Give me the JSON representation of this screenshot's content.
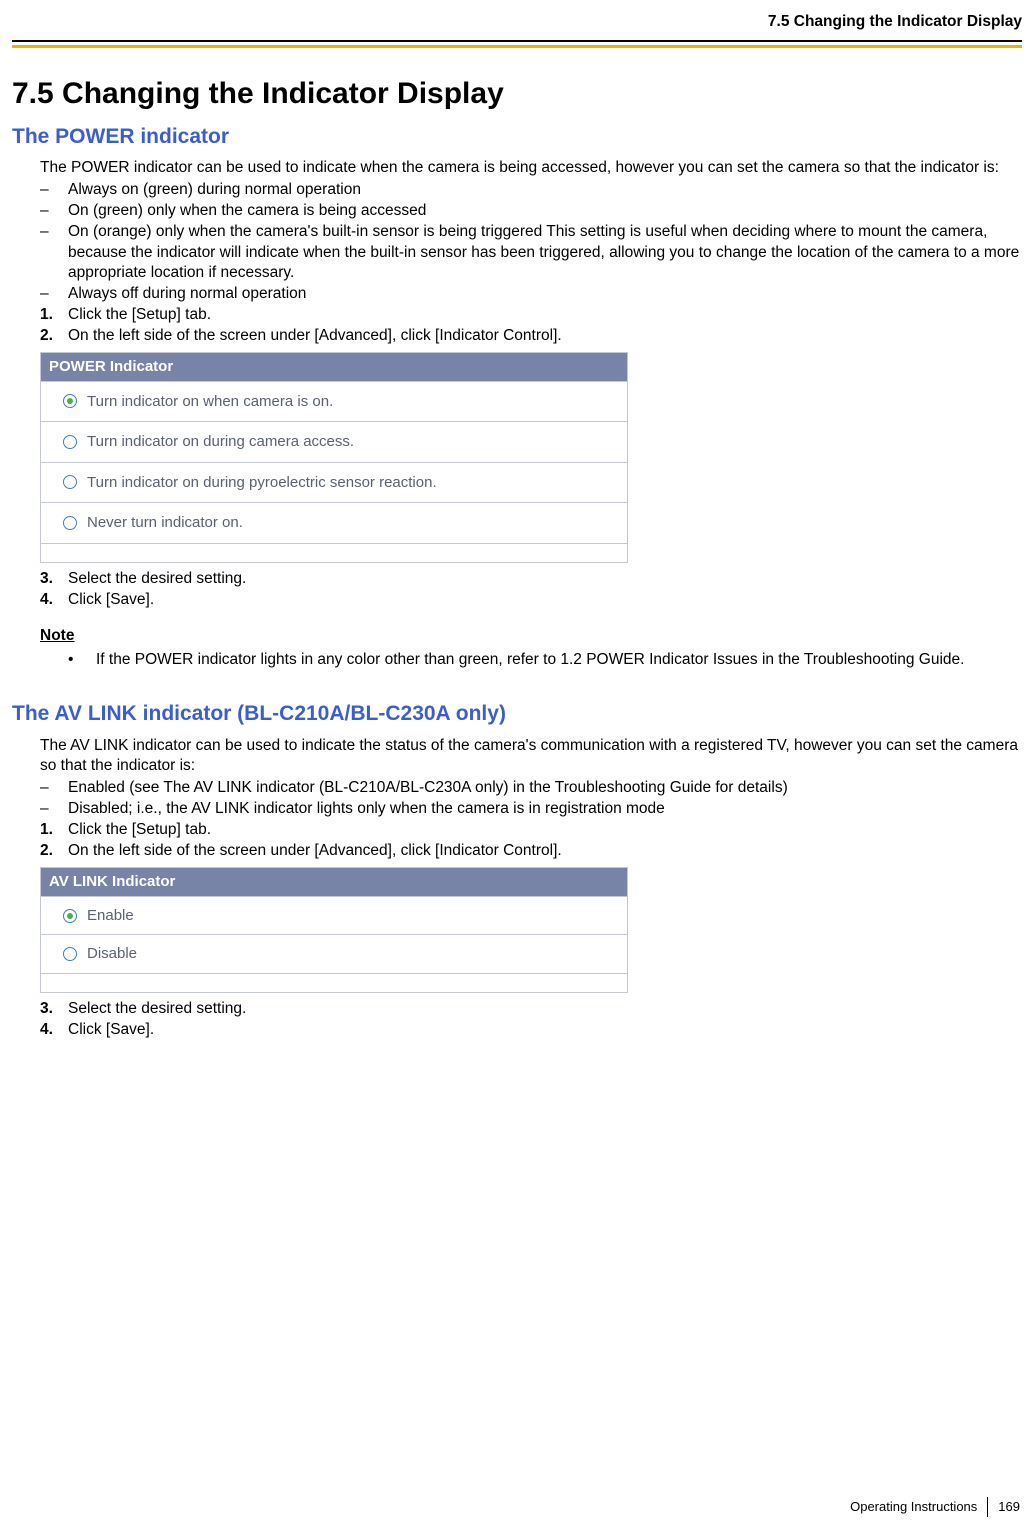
{
  "header": {
    "running": "7.5 Changing the Indicator Display"
  },
  "title": "7.5  Changing the Indicator Display",
  "sec1": {
    "heading": "The POWER indicator",
    "intro": "The POWER indicator can be used to indicate when the camera is being accessed, however you can set the camera so that the indicator is:",
    "dashes": [
      "Always on (green) during normal operation",
      "On (green) only when the camera is being accessed",
      "On (orange) only when the camera's built-in sensor is being triggered\nThis setting is useful when deciding where to mount the camera, because the indicator will indicate when the built-in sensor has been triggered, allowing you to change the location of the camera to a more appropriate location if necessary.",
      "Always off during normal operation"
    ],
    "steps1": [
      "Click the [Setup] tab.",
      "On the left side of the screen under [Advanced], click [Indicator Control]."
    ],
    "panel": {
      "title": "POWER Indicator",
      "options": [
        {
          "label": "Turn indicator on when camera is on.",
          "checked": true
        },
        {
          "label": "Turn indicator on during camera access.",
          "checked": false
        },
        {
          "label": "Turn indicator on during pyroelectric sensor reaction.",
          "checked": false
        },
        {
          "label": "Never turn indicator on.",
          "checked": false
        }
      ]
    },
    "steps2": [
      "Select the desired setting.",
      "Click [Save]."
    ],
    "noteLabel": "Note",
    "noteText": "If the POWER indicator lights in any color other than green, refer to 1.2  POWER Indicator Issues in the Troubleshooting Guide."
  },
  "sec2": {
    "heading": "The AV LINK indicator (BL-C210A/BL-C230A only)",
    "intro": "The AV LINK indicator can be used to indicate the status of the camera's communication with a registered TV, however you can set the camera so that the indicator is:",
    "dashes": [
      "Enabled (see The AV LINK indicator (BL-C210A/BL-C230A only) in the Troubleshooting Guide for details)",
      "Disabled; i.e., the AV LINK indicator lights only when the camera is in registration mode"
    ],
    "steps1": [
      "Click the [Setup] tab.",
      "On the left side of the screen under [Advanced], click [Indicator Control]."
    ],
    "panel": {
      "title": "AV LINK Indicator",
      "options": [
        {
          "label": "Enable",
          "checked": true
        },
        {
          "label": "Disable",
          "checked": false
        }
      ]
    },
    "steps2": [
      "Select the desired setting.",
      "Click [Save]."
    ]
  },
  "footer": {
    "doc": "Operating Instructions",
    "page": "169"
  }
}
